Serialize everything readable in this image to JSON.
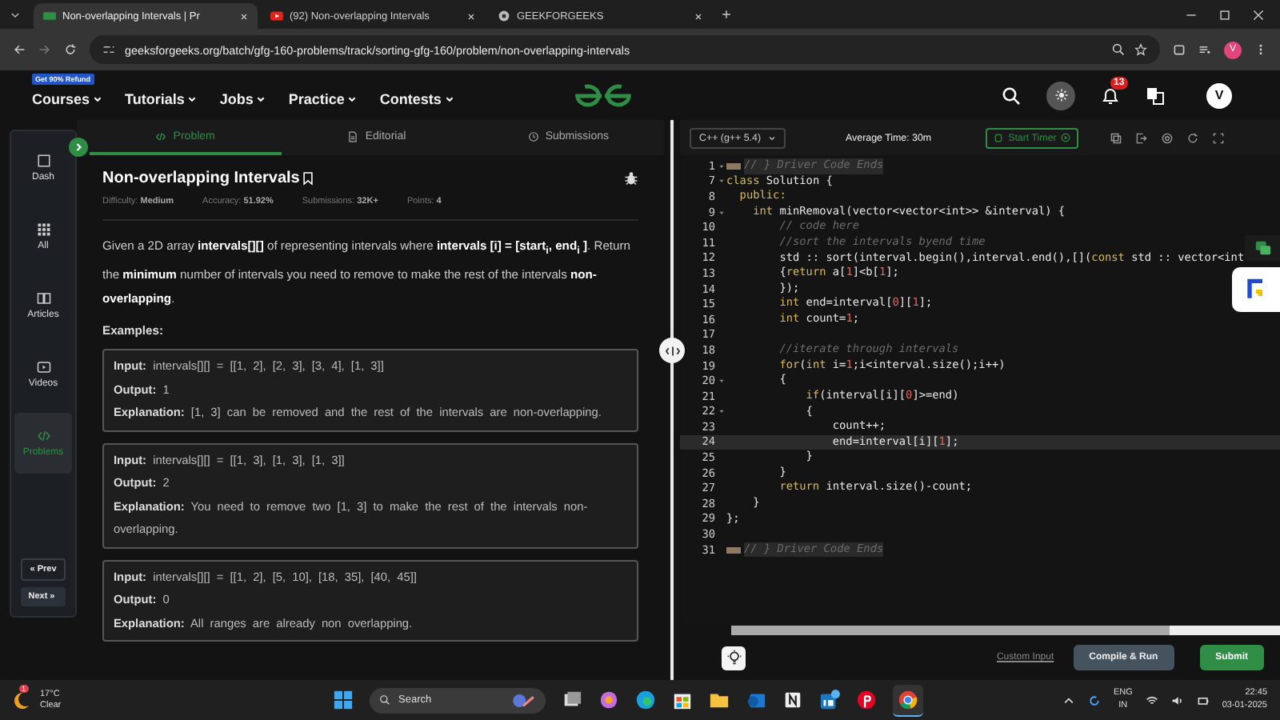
{
  "browser": {
    "tabs": [
      {
        "title": "Non-overlapping Intervals | Pr",
        "selected": true,
        "kind": "site"
      },
      {
        "title": "(92) Non-overlapping Intervals",
        "selected": false,
        "kind": "video"
      },
      {
        "title": "GEEKFORGEEKS",
        "selected": false,
        "kind": "gear"
      }
    ],
    "address": "geeksforgeeks.org/batch/gfg-160-problems/track/sorting-gfg-160/problem/non-overlapping-intervals",
    "profile": "V"
  },
  "header": {
    "promo": "Get 90% Refund",
    "nav": [
      "Courses",
      "Tutorials",
      "Jobs",
      "Practice",
      "Contests"
    ],
    "notifications": "13",
    "avatar": "V"
  },
  "sidebar": {
    "items": [
      {
        "label": "Dash",
        "selected": false
      },
      {
        "label": "All",
        "selected": false
      },
      {
        "label": "Articles",
        "selected": false
      },
      {
        "label": "Videos",
        "selected": false
      },
      {
        "label": "Problems",
        "selected": true
      }
    ],
    "prev": "« Prev",
    "next": "Next »"
  },
  "problem_tabs": [
    {
      "label": "Problem",
      "selected": true
    },
    {
      "label": "Editorial",
      "selected": false
    },
    {
      "label": "Submissions",
      "selected": false
    }
  ],
  "problem": {
    "title": "Non-overlapping Intervals",
    "meta": [
      {
        "label": "Difficulty:",
        "value": "Medium"
      },
      {
        "label": "Accuracy:",
        "value": "51.92%"
      },
      {
        "label": "Submissions:",
        "value": "32K+"
      },
      {
        "label": "Points:",
        "value": "4"
      }
    ],
    "description": "Given a 2D array **intervals[][]** of representing intervals where **intervals [i] = [start$_{i}$, end$_{i}$ ]**. Return the **minimum** number of intervals you need to remove to make the rest of the intervals **non-overlapping**.",
    "examples_heading": "Examples:",
    "examples": [
      [
        {
          "label": "Input:",
          "value": "intervals[][] = [[1, 2], [2, 3], [3, 4], [1, 3]]"
        },
        {
          "label": "Output:",
          "value": "1"
        },
        {
          "label": "Explanation:",
          "value": "[1, 3] can be removed and the rest of the intervals are non-overlapping."
        }
      ],
      [
        {
          "label": "Input:",
          "value": "intervals[][] = [[1, 3], [1, 3], [1, 3]]"
        },
        {
          "label": "Output:",
          "value": "2"
        },
        {
          "label": "Explanation:",
          "value": "You need to remove two [1, 3] to make the rest of the intervals non-overlapping."
        }
      ],
      [
        {
          "label": "Input:",
          "value": "intervals[][] = [[1, 2], [5, 10], [18, 35], [40, 45]]"
        },
        {
          "label": "Output:",
          "value": "0"
        },
        {
          "label": "Explanation:",
          "value": "All ranges are already non overlapping."
        }
      ]
    ]
  },
  "editor": {
    "language": "C++ (g++ 5.4)",
    "average_time": "Average Time: 30m",
    "timer_button": "Start Timer",
    "lines": [
      {
        "n": "1",
        "fold": true,
        "collapsed": true,
        "current": false,
        "tokens": [
          {
            "kind": "cm",
            "t": "// } Driver Code Ends"
          }
        ]
      },
      {
        "n": "7",
        "fold": true,
        "collapsed": false,
        "current": false,
        "tokens": [
          {
            "kind": "kw",
            "t": "class"
          },
          {
            "kind": "pl",
            "t": " Solution {"
          }
        ]
      },
      {
        "n": "8",
        "fold": false,
        "collapsed": false,
        "current": false,
        "tokens": [
          {
            "kind": "kw",
            "t": "  public:"
          }
        ]
      },
      {
        "n": "9",
        "fold": true,
        "collapsed": false,
        "current": false,
        "tokens": [
          {
            "kind": "kw",
            "t": "    int"
          },
          {
            "kind": "pl",
            "t": " minRemoval(vector<vector<int>> &interval) {"
          }
        ]
      },
      {
        "n": "10",
        "fold": false,
        "collapsed": false,
        "current": false,
        "tokens": [
          {
            "kind": "cm",
            "t": "        // code here"
          }
        ]
      },
      {
        "n": "11",
        "fold": false,
        "collapsed": false,
        "current": false,
        "tokens": [
          {
            "kind": "cm",
            "t": "        //sort the intervals byend time"
          }
        ]
      },
      {
        "n": "12",
        "fold": false,
        "collapsed": false,
        "current": false,
        "tokens": [
          {
            "kind": "pl",
            "t": "        std :: sort(interval.begin(),interval.end(),[]("
          },
          {
            "kind": "kw",
            "t": "const"
          },
          {
            "kind": "pl",
            "t": " std :: vector<int"
          }
        ]
      },
      {
        "n": "13",
        "fold": false,
        "collapsed": false,
        "current": false,
        "tokens": [
          {
            "kind": "pl",
            "t": "        {"
          },
          {
            "kind": "kw",
            "t": "return"
          },
          {
            "kind": "pl",
            "t": " a["
          },
          {
            "kind": "num",
            "t": "1"
          },
          {
            "kind": "pl",
            "t": "]<b["
          },
          {
            "kind": "num",
            "t": "1"
          },
          {
            "kind": "pl",
            "t": "];"
          }
        ]
      },
      {
        "n": "14",
        "fold": false,
        "collapsed": false,
        "current": false,
        "tokens": [
          {
            "kind": "pl",
            "t": "        });"
          }
        ]
      },
      {
        "n": "15",
        "fold": false,
        "collapsed": false,
        "current": false,
        "tokens": [
          {
            "kind": "kw",
            "t": "        int"
          },
          {
            "kind": "pl",
            "t": " end=interval["
          },
          {
            "kind": "num",
            "t": "0"
          },
          {
            "kind": "pl",
            "t": "]["
          },
          {
            "kind": "num",
            "t": "1"
          },
          {
            "kind": "pl",
            "t": "];"
          }
        ]
      },
      {
        "n": "16",
        "fold": false,
        "collapsed": false,
        "current": false,
        "tokens": [
          {
            "kind": "kw",
            "t": "        int"
          },
          {
            "kind": "pl",
            "t": " count="
          },
          {
            "kind": "num",
            "t": "1"
          },
          {
            "kind": "pl",
            "t": ";"
          }
        ]
      },
      {
        "n": "17",
        "fold": false,
        "collapsed": false,
        "current": false
      },
      {
        "n": "18",
        "fold": false,
        "collapsed": false,
        "current": false,
        "tokens": [
          {
            "kind": "cm",
            "t": "        //iterate through intervals"
          }
        ]
      },
      {
        "n": "19",
        "fold": false,
        "collapsed": false,
        "current": false,
        "tokens": [
          {
            "kind": "kw",
            "t": "        for"
          },
          {
            "kind": "pl",
            "t": "("
          },
          {
            "kind": "kw",
            "t": "int"
          },
          {
            "kind": "pl",
            "t": " i="
          },
          {
            "kind": "num",
            "t": "1"
          },
          {
            "kind": "pl",
            "t": ";i<interval.size();i++)"
          }
        ]
      },
      {
        "n": "20",
        "fold": true,
        "collapsed": false,
        "current": false,
        "tokens": [
          {
            "kind": "pl",
            "t": "        {"
          }
        ]
      },
      {
        "n": "21",
        "fold": false,
        "collapsed": false,
        "current": false,
        "tokens": [
          {
            "kind": "kw",
            "t": "            if"
          },
          {
            "kind": "pl",
            "t": "(interval[i]["
          },
          {
            "kind": "num",
            "t": "0"
          },
          {
            "kind": "pl",
            "t": "]>=end)"
          }
        ]
      },
      {
        "n": "22",
        "fold": true,
        "collapsed": false,
        "current": false,
        "tokens": [
          {
            "kind": "pl",
            "t": "            {"
          }
        ]
      },
      {
        "n": "23",
        "fold": false,
        "collapsed": false,
        "current": false,
        "tokens": [
          {
            "kind": "pl",
            "t": "                count++;"
          }
        ]
      },
      {
        "n": "24",
        "fold": false,
        "collapsed": false,
        "current": true,
        "tokens": [
          {
            "kind": "pl",
            "t": "                end=interval[i]["
          },
          {
            "kind": "num",
            "t": "1"
          },
          {
            "kind": "pl",
            "t": "];"
          }
        ]
      },
      {
        "n": "25",
        "fold": false,
        "collapsed": false,
        "current": false,
        "tokens": [
          {
            "kind": "pl",
            "t": "            }"
          }
        ]
      },
      {
        "n": "26",
        "fold": false,
        "collapsed": false,
        "current": false,
        "tokens": [
          {
            "kind": "pl",
            "t": "        }"
          }
        ]
      },
      {
        "n": "27",
        "fold": false,
        "collapsed": false,
        "current": false,
        "tokens": [
          {
            "kind": "kw",
            "t": "        return"
          },
          {
            "kind": "pl",
            "t": " interval.size()-count;"
          }
        ]
      },
      {
        "n": "28",
        "fold": false,
        "collapsed": false,
        "current": false,
        "tokens": [
          {
            "kind": "pl",
            "t": "    }"
          }
        ]
      },
      {
        "n": "29",
        "fold": false,
        "collapsed": false,
        "current": false,
        "tokens": [
          {
            "kind": "pl",
            "t": "};"
          }
        ]
      },
      {
        "n": "30",
        "fold": false,
        "collapsed": false,
        "current": false
      },
      {
        "n": "31",
        "fold": false,
        "collapsed": true,
        "current": false,
        "tokens": [
          {
            "kind": "cm",
            "t": "// } Driver Code Ends"
          }
        ]
      }
    ],
    "custom_input": "Custom Input",
    "compile_button": "Compile & Run",
    "submit_button": "Submit"
  },
  "taskbar": {
    "temperature": "17°C",
    "weather": "Clear",
    "weather_badge": "1",
    "search": "Search",
    "language": "ENG",
    "region": "IN",
    "time": "22:45",
    "date": "03-01-2025"
  }
}
